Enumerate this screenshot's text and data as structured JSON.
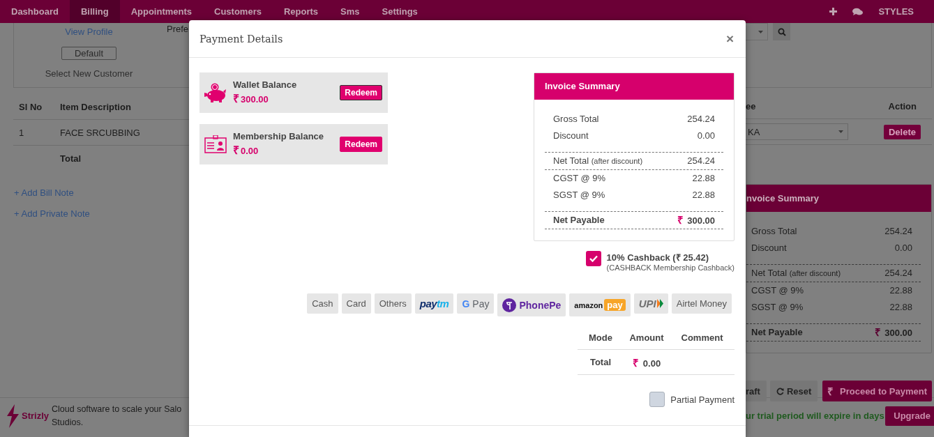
{
  "nav": {
    "items": [
      {
        "label": "Dashboard",
        "selected": false
      },
      {
        "label": "Billing",
        "selected": true
      },
      {
        "label": "Appointments",
        "selected": false
      },
      {
        "label": "Customers",
        "selected": false
      },
      {
        "label": "Reports",
        "selected": false
      },
      {
        "label": "Sms",
        "selected": false
      },
      {
        "label": "Settings",
        "selected": false
      }
    ],
    "styles_label": "STYLES"
  },
  "customer_panel": {
    "view_profile": "View Profile",
    "default_button": "Default",
    "select_new": "Select New Customer",
    "column_2_label": "Prefe"
  },
  "bill_table": {
    "columns": [
      "Sl No",
      "Item Description"
    ],
    "rows": [
      {
        "sl_no": "1",
        "item": "FACE SRCUBBING"
      }
    ],
    "total_label": "Total"
  },
  "notes": [
    "+ Add Bill Note",
    "+ Add Private Note"
  ],
  "item_table_right": {
    "columns": [
      "ee",
      "Action"
    ],
    "rows": [
      {
        "select_value": "KA",
        "action": "Delete"
      }
    ]
  },
  "background_summary": {
    "title": "nvoice Summary",
    "groups": [
      {
        "rows": [
          {
            "kind": "line",
            "label": "Gross Total",
            "value": "254.24"
          },
          {
            "kind": "line",
            "label": "Discount",
            "value": "0.00"
          }
        ]
      },
      {
        "rows": [
          {
            "kind": "line",
            "label": "Net Total",
            "note": "(after discount)",
            "value": "254.24"
          }
        ]
      },
      {
        "rows": [
          {
            "kind": "line",
            "label": "CGST @ 9%",
            "value": "22.88"
          },
          {
            "kind": "line",
            "label": "SGST @ 9%",
            "value": "22.88"
          }
        ]
      },
      {
        "rows": [
          {
            "kind": "total",
            "label": "Net Payable",
            "currency": "₹",
            "value": "300.00"
          }
        ]
      }
    ]
  },
  "bill_actions": [
    {
      "kind": "plain",
      "label": "raft"
    },
    {
      "kind": "reset",
      "label": "Reset"
    },
    {
      "kind": "pay",
      "currency": "₹",
      "label": "Proceed to Payment"
    }
  ],
  "footer": {
    "brand": "Strizly",
    "tagline": [
      "Cloud software to scale your Salo",
      "Studios."
    ],
    "trial_text": "ur trial period will expire in days",
    "upgrade": "Upgrade"
  },
  "modal": {
    "title": "Payment Details",
    "close": "×",
    "balances": [
      {
        "kind": "wallet",
        "label": "Wallet Balance",
        "currency": "₹",
        "amount": "300.00",
        "button": "Redeem"
      },
      {
        "kind": "membership",
        "label": "Membership Balance",
        "currency": "₹",
        "amount": "0.00",
        "button": "Redeem"
      }
    ],
    "invoice_summary": {
      "title": "Invoice Summary",
      "groups": [
        {
          "rows": [
            {
              "kind": "line",
              "label": "Gross Total",
              "value": "254.24"
            },
            {
              "kind": "line",
              "label": "Discount",
              "value": "0.00"
            }
          ]
        },
        {
          "rows": [
            {
              "kind": "line",
              "label": "Net Total",
              "note": "(after discount)",
              "value": "254.24"
            }
          ]
        },
        {
          "rows": [
            {
              "kind": "line",
              "label": "CGST @ 9%",
              "value": "22.88"
            },
            {
              "kind": "line",
              "label": "SGST @ 9%",
              "value": "22.88"
            }
          ]
        },
        {
          "rows": [
            {
              "kind": "total",
              "label": "Net Payable",
              "currency": "₹",
              "value": "300.00"
            }
          ]
        }
      ]
    },
    "cashback": {
      "checked": true,
      "label": "10% Cashback (₹ 25.42)",
      "detail": "(CASHBACK Membership Cashback)"
    },
    "payment_methods": [
      {
        "kind": "text",
        "label": "Cash"
      },
      {
        "kind": "text",
        "label": "Card"
      },
      {
        "kind": "text",
        "label": "Others"
      },
      {
        "kind": "paytm",
        "parts": [
          "pay",
          "tm"
        ]
      },
      {
        "kind": "gpay",
        "parts": [
          "G",
          "Pay"
        ]
      },
      {
        "kind": "phonepe",
        "label": "PhonePe"
      },
      {
        "kind": "amazonpay",
        "parts": [
          "amazon",
          "pay"
        ]
      },
      {
        "kind": "upi",
        "label": "UPI"
      },
      {
        "kind": "text",
        "label": "Airtel Money"
      }
    ],
    "payments_table": {
      "columns": [
        "Mode",
        "Amount",
        "Comment"
      ],
      "rows": [
        {
          "mode": "Total",
          "currency": "₹",
          "amount": "0.00"
        }
      ]
    },
    "partial_payment": {
      "checked": false,
      "label": "Partial Payment"
    }
  }
}
